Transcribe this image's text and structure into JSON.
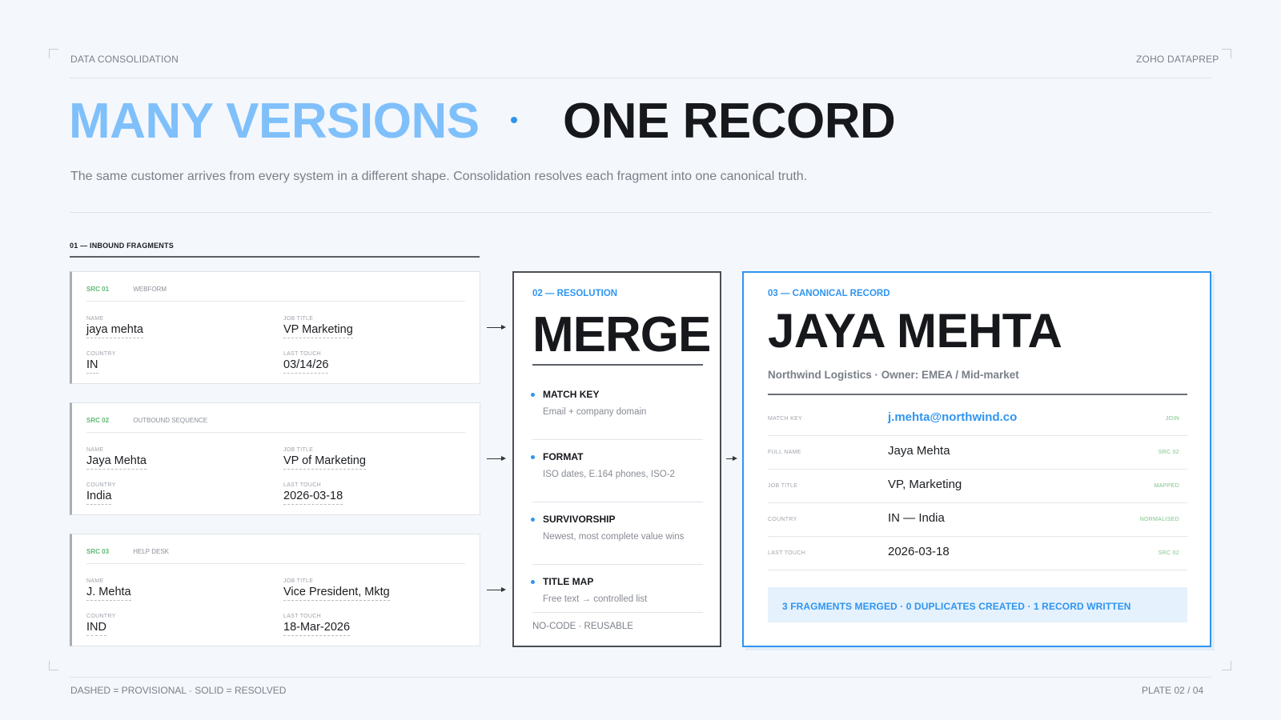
{
  "header": {
    "left_label": "DATA CONSOLIDATION",
    "right_label": "ZOHO DATAPREP"
  },
  "title": {
    "part1": "MANY VERSIONS",
    "part2": "ONE RECORD"
  },
  "subtitle": "The same customer arrives from every system in a different shape. Consolidation resolves each fragment into one canonical truth.",
  "fragments_section": {
    "label": "01 — INBOUND FRAGMENTS",
    "fragments": [
      {
        "src": "SRC 01",
        "system": "WEBFORM",
        "name_label": "NAME",
        "name": "jaya mehta",
        "title_label": "JOB TITLE",
        "title": "VP Marketing",
        "country_label": "COUNTRY",
        "country": "IN",
        "touch_label": "LAST TOUCH",
        "touch": "03/14/26"
      },
      {
        "src": "SRC 02",
        "system": "OUTBOUND SEQUENCE",
        "name_label": "NAME",
        "name": "Jaya Mehta",
        "title_label": "JOB TITLE",
        "title": "VP of Marketing",
        "country_label": "COUNTRY",
        "country": "India",
        "touch_label": "LAST TOUCH",
        "touch": "2026-03-18"
      },
      {
        "src": "SRC 03",
        "system": "HELP DESK",
        "name_label": "NAME",
        "name": "J. Mehta",
        "title_label": "JOB TITLE",
        "title": "Vice President, Mktg",
        "country_label": "COUNTRY",
        "country": "IND",
        "touch_label": "LAST TOUCH",
        "touch": "18-Mar-2026"
      }
    ]
  },
  "resolution": {
    "label": "02 — RESOLUTION",
    "title": "MERGE",
    "steps": [
      {
        "title": "MATCH KEY",
        "desc": "Email + company domain"
      },
      {
        "title": "FORMAT",
        "desc": "ISO dates, E.164 phones, ISO-2"
      },
      {
        "title": "SURVIVORSHIP",
        "desc": "Newest, most complete value wins"
      },
      {
        "title": "TITLE MAP",
        "desc": "Free text → controlled list"
      }
    ],
    "footer": "NO-CODE · REUSABLE"
  },
  "canonical": {
    "label": "03 — CANONICAL RECORD",
    "name": "JAYA MEHTA",
    "subtitle": "Northwind Logistics · Owner: EMEA / Mid-market",
    "rows": [
      {
        "label": "MATCH KEY",
        "value": "j.mehta@northwind.co",
        "tag": "JOIN"
      },
      {
        "label": "FULL NAME",
        "value": "Jaya Mehta",
        "tag": "SRC 02"
      },
      {
        "label": "JOB TITLE",
        "value": "VP, Marketing",
        "tag": "MAPPED"
      },
      {
        "label": "COUNTRY",
        "value": "IN — India",
        "tag": "NORMALISED"
      },
      {
        "label": "LAST TOUCH",
        "value": "2026-03-18",
        "tag": "SRC 02"
      }
    ],
    "summary": "3 FRAGMENTS MERGED · 0 DUPLICATES CREATED · 1 RECORD WRITTEN"
  },
  "footer": {
    "legend": "DASHED = PROVISIONAL · SOLID = RESOLVED",
    "plate": "PLATE 02 / 04"
  },
  "colors": {
    "accent": "#2f95ef",
    "title_light": "#7fc0fb",
    "source_green": "#5fb874",
    "background": "#f4f7fc"
  }
}
